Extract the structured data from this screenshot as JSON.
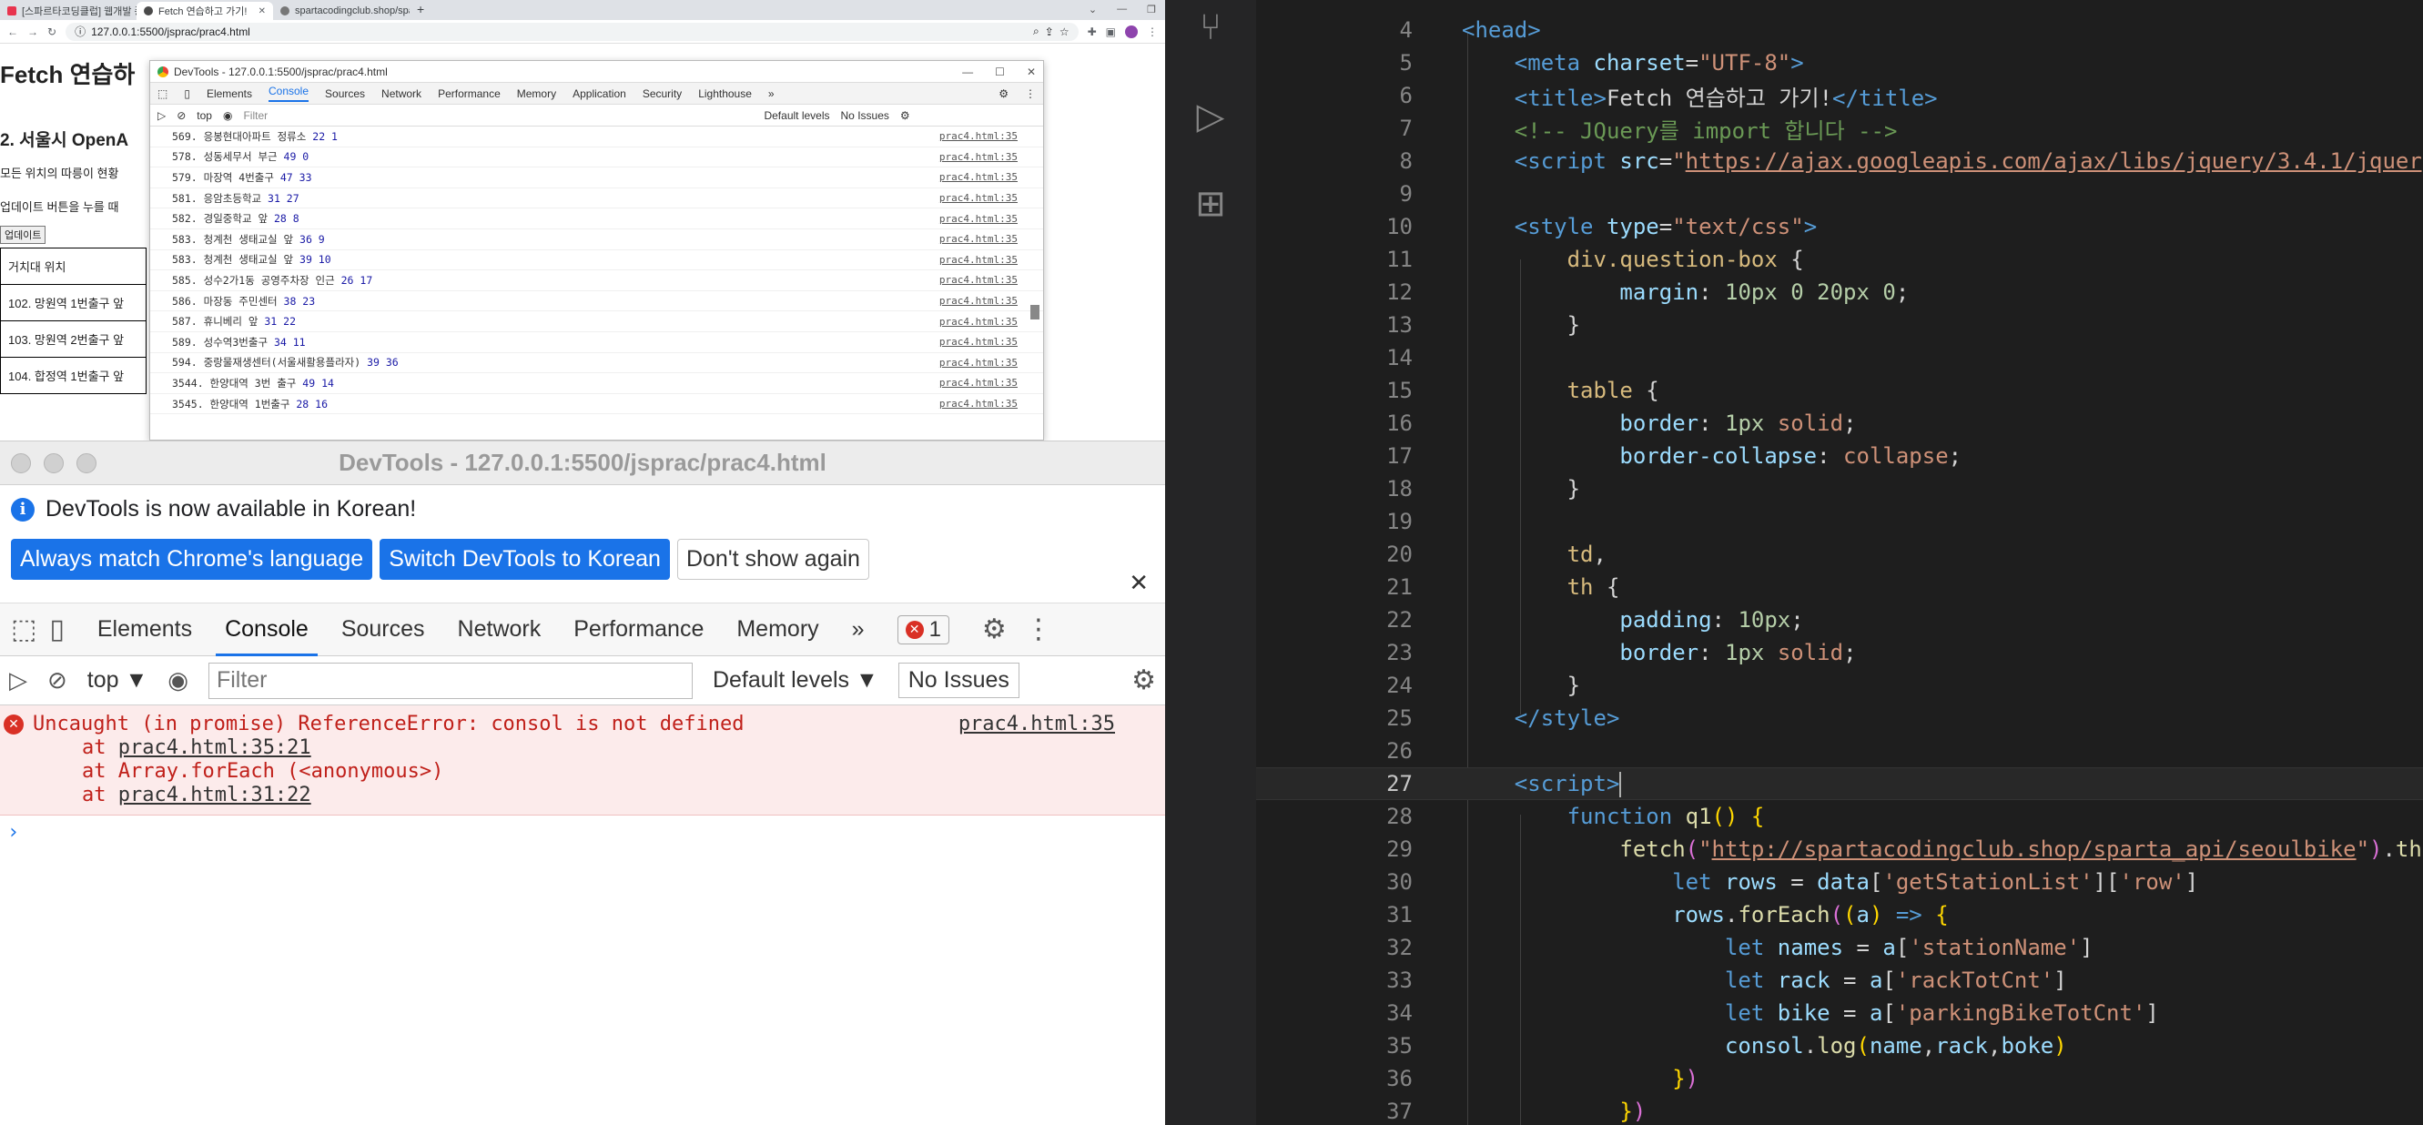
{
  "browser": {
    "tabs": [
      {
        "title": "[스파르타코딩클럽] 웹개발 종합",
        "active": false
      },
      {
        "title": "Fetch 연습하고 가기!",
        "active": true
      },
      {
        "title": "spartacodingclub.shop/sparta_a",
        "active": false
      }
    ],
    "url": "127.0.0.1:5500/jsprac/prac4.html",
    "page": {
      "title": "Fetch 연습하",
      "section_title": "2. 서울시 OpenA",
      "desc1": "모든 위치의 따릉이 현황",
      "desc2": "업데이트 버튼을 누를 때",
      "update_button": "업데이트",
      "table_header": "거치대 위치",
      "rows": [
        "102. 망원역 1번출구 앞",
        "103. 망원역 2번출구 앞",
        "104. 합정역 1번출구 앞"
      ]
    }
  },
  "devtools_small": {
    "title": "DevTools - 127.0.0.1:5500/jsprac/prac4.html",
    "tabs": [
      "Elements",
      "Console",
      "Sources",
      "Network",
      "Performance",
      "Memory",
      "Application",
      "Security",
      "Lighthouse"
    ],
    "active_tab": "Console",
    "context": "top",
    "filter_placeholder": "Filter",
    "levels": "Default levels",
    "issues": "No Issues",
    "log_rows": [
      {
        "text": "569. 응봉현대아파트 정류소",
        "a": "22",
        "b": "1",
        "src": "prac4.html:35"
      },
      {
        "text": "578. 성동세무서 부근",
        "a": "49",
        "b": "0",
        "src": "prac4.html:35"
      },
      {
        "text": "579. 마장역 4번출구",
        "a": "47",
        "b": "33",
        "src": "prac4.html:35"
      },
      {
        "text": "581. 응암초등학교",
        "a": "31",
        "b": "27",
        "src": "prac4.html:35"
      },
      {
        "text": "582. 경일중학교 앞",
        "a": "28",
        "b": "8",
        "src": "prac4.html:35"
      },
      {
        "text": "583. 청계천 생태교실 앞",
        "a": "36",
        "b": "9",
        "src": "prac4.html:35"
      },
      {
        "text": "583. 청계천 생태교실 앞",
        "a": "39",
        "b": "10",
        "src": "prac4.html:35"
      },
      {
        "text": "585. 성수2가1동 공영주차장 인근",
        "a": "26",
        "b": "17",
        "src": "prac4.html:35"
      },
      {
        "text": "586. 마장동 주민센터",
        "a": "38",
        "b": "23",
        "src": "prac4.html:35"
      },
      {
        "text": "587. 휴니베리 앞",
        "a": "31",
        "b": "22",
        "src": "prac4.html:35"
      },
      {
        "text": "589. 성수역3번출구",
        "a": "34",
        "b": "11",
        "src": "prac4.html:35"
      },
      {
        "text": "594. 중랑물재생센터(서울새활용플라자)",
        "a": "39",
        "b": "36",
        "src": "prac4.html:35"
      },
      {
        "text": "3544. 한양대역 3번 출구",
        "a": "49",
        "b": "14",
        "src": "prac4.html:35"
      },
      {
        "text": "3545. 한양대역 1번출구",
        "a": "28",
        "b": "16",
        "src": "prac4.html:35"
      }
    ]
  },
  "devtools_big": {
    "title": "DevTools - 127.0.0.1:5500/jsprac/prac4.html",
    "info_message": "DevTools is now available in Korean!",
    "btn_match": "Always match Chrome's language",
    "btn_switch": "Switch DevTools to Korean",
    "btn_dismiss": "Don't show again",
    "tabs": [
      "Elements",
      "Console",
      "Sources",
      "Network",
      "Performance",
      "Memory"
    ],
    "active_tab": "Console",
    "more": "»",
    "error_count": "1",
    "context": "top",
    "filter_placeholder": "Filter",
    "levels": "Default levels",
    "issues": "No Issues",
    "error": {
      "message": "Uncaught (in promise) ReferenceError: consol is not defined",
      "location": "prac4.html:35",
      "stack": [
        {
          "prefix": "at ",
          "link": "prac4.html:35:21",
          "suffix": ""
        },
        {
          "prefix": "at Array.forEach (<anonymous>)",
          "link": "",
          "suffix": ""
        },
        {
          "prefix": "at ",
          "link": "prac4.html:31:22",
          "suffix": ""
        }
      ]
    },
    "prompt": "›"
  },
  "editor": {
    "first_line": 4,
    "current_line": 27
  }
}
